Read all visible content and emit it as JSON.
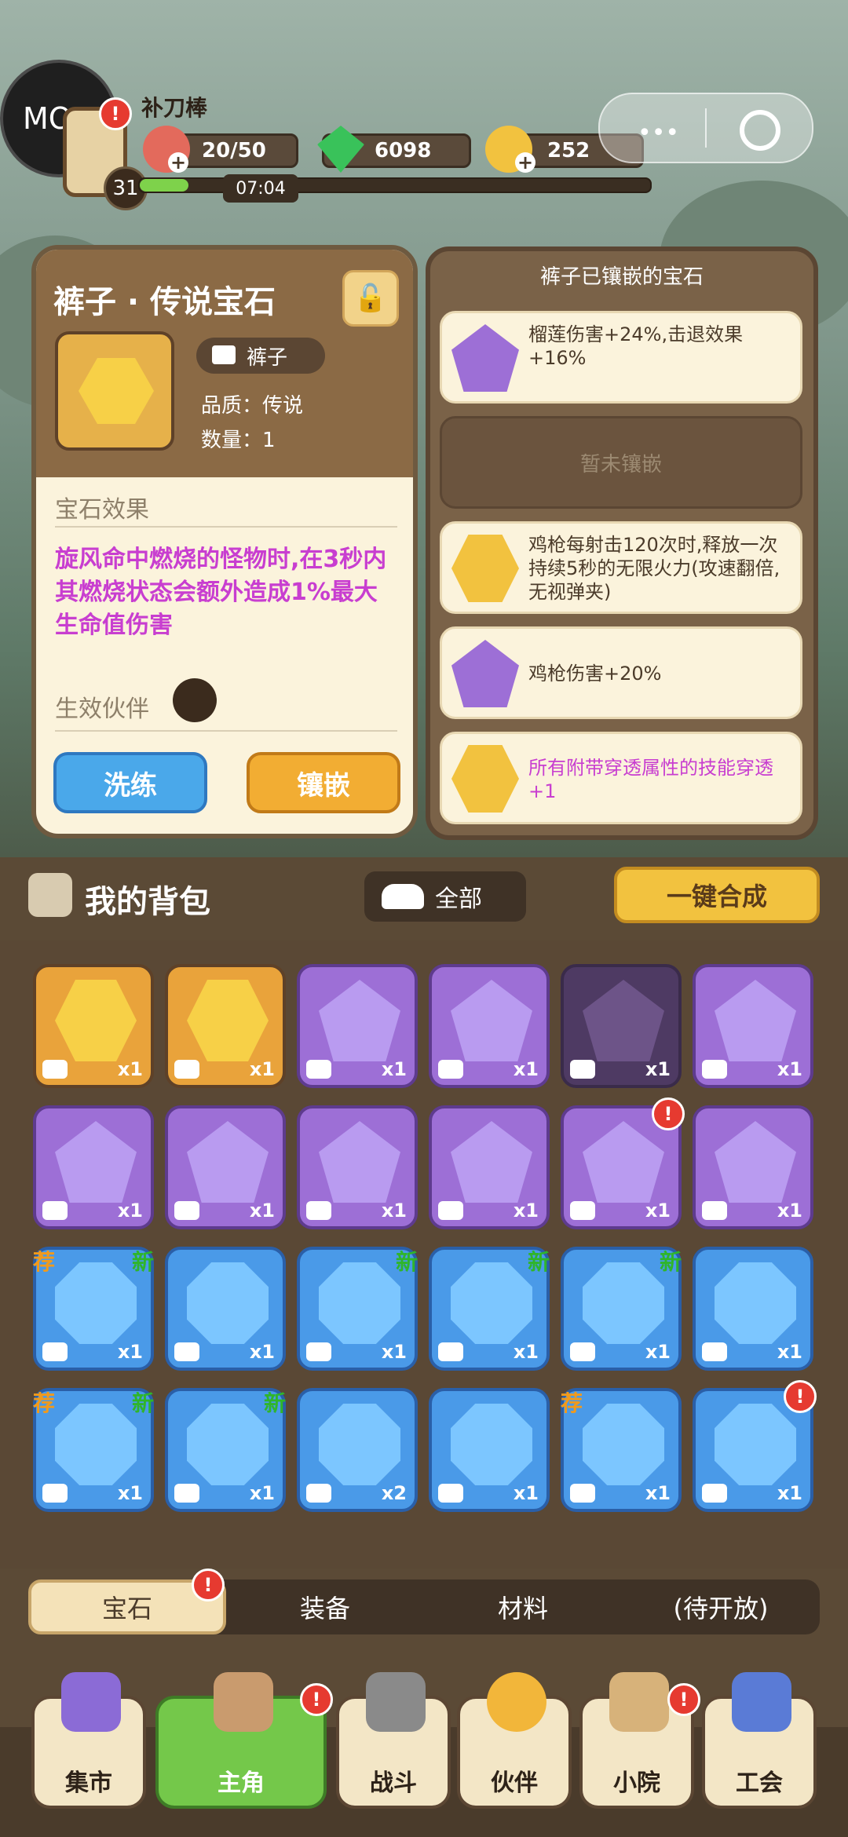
{
  "hud": {
    "mod_label": "MOD",
    "player_name": "补刀棒",
    "level": "31",
    "stamina": "20/50",
    "gems": "6098",
    "coins": "252",
    "timer": "07:04",
    "xp_progress": 0.1
  },
  "detail": {
    "title": "裤子 · 传说宝石",
    "slot_label": "裤子",
    "quality": "品质：传说",
    "quantity": "数量：1",
    "effect_header": "宝石效果",
    "effect_text": "旋风命中燃烧的怪物时,在3秒内其燃烧状态会额外造成1%最大生命值伤害",
    "partner_label": "生效伙伴",
    "btn_reforge": "洗练",
    "btn_inlay": "镶嵌"
  },
  "inlaid": {
    "title": "裤子已镶嵌的宝石",
    "slots": [
      {
        "text": "榴莲伤害+24%,击退效果+16%",
        "kind": "purple",
        "pink": false
      },
      {
        "text": "暂未镶嵌",
        "kind": "empty"
      },
      {
        "text": "鸡枪每射击120次时,释放一次持续5秒的无限火力(攻速翻倍,无视弹夹)",
        "kind": "gold",
        "pink": false
      },
      {
        "text": "鸡枪伤害+20%",
        "kind": "purple",
        "pink": false
      },
      {
        "text": "所有附带穿透属性的技能穿透+1",
        "kind": "gold",
        "pink": true
      }
    ]
  },
  "bag": {
    "title": "我的背包",
    "filter": "全部",
    "merge": "一键合成",
    "tiles": [
      {
        "kind": "gold",
        "count": "x1"
      },
      {
        "kind": "gold",
        "count": "x1"
      },
      {
        "kind": "purple",
        "count": "x1"
      },
      {
        "kind": "purple",
        "count": "x1"
      },
      {
        "kind": "dark",
        "count": "x1"
      },
      {
        "kind": "purple",
        "count": "x1"
      },
      {
        "kind": "purple",
        "count": "x1"
      },
      {
        "kind": "purple",
        "count": "x1"
      },
      {
        "kind": "purple",
        "count": "x1"
      },
      {
        "kind": "purple",
        "count": "x1"
      },
      {
        "kind": "purple",
        "count": "x1",
        "alert": "!"
      },
      {
        "kind": "purple",
        "count": "x1"
      },
      {
        "kind": "blue",
        "count": "x1",
        "rec": "荐",
        "new": "新"
      },
      {
        "kind": "blue",
        "count": "x1"
      },
      {
        "kind": "blue",
        "count": "x1",
        "new": "新"
      },
      {
        "kind": "blue",
        "count": "x1",
        "new": "新"
      },
      {
        "kind": "blue",
        "count": "x1",
        "new": "新"
      },
      {
        "kind": "blue",
        "count": "x1"
      },
      {
        "kind": "blue",
        "count": "x1",
        "rec": "荐",
        "new": "新"
      },
      {
        "kind": "blue",
        "count": "x1",
        "new": "新"
      },
      {
        "kind": "blue",
        "count": "x2"
      },
      {
        "kind": "blue",
        "count": "x1"
      },
      {
        "kind": "blue",
        "count": "x1",
        "rec": "荐"
      },
      {
        "kind": "blue",
        "count": "x1",
        "alert": "!"
      }
    ]
  },
  "tabs": [
    "宝石",
    "装备",
    "材料",
    "(待开放)"
  ],
  "nav": [
    {
      "label": "集市"
    },
    {
      "label": "主角"
    },
    {
      "label": "战斗"
    },
    {
      "label": "伙伴"
    },
    {
      "label": "小院"
    },
    {
      "label": "工会"
    }
  ],
  "colors": {
    "accent_gold": "#f2ad33",
    "accent_blue": "#4aa8ea",
    "effect_pink": "#c83ed0"
  },
  "icons": [
    "meat-icon",
    "gem-icon",
    "coin-icon",
    "lock-icon",
    "pants-icon",
    "flower-icon",
    "backpack-icon",
    "cloud-icon"
  ]
}
